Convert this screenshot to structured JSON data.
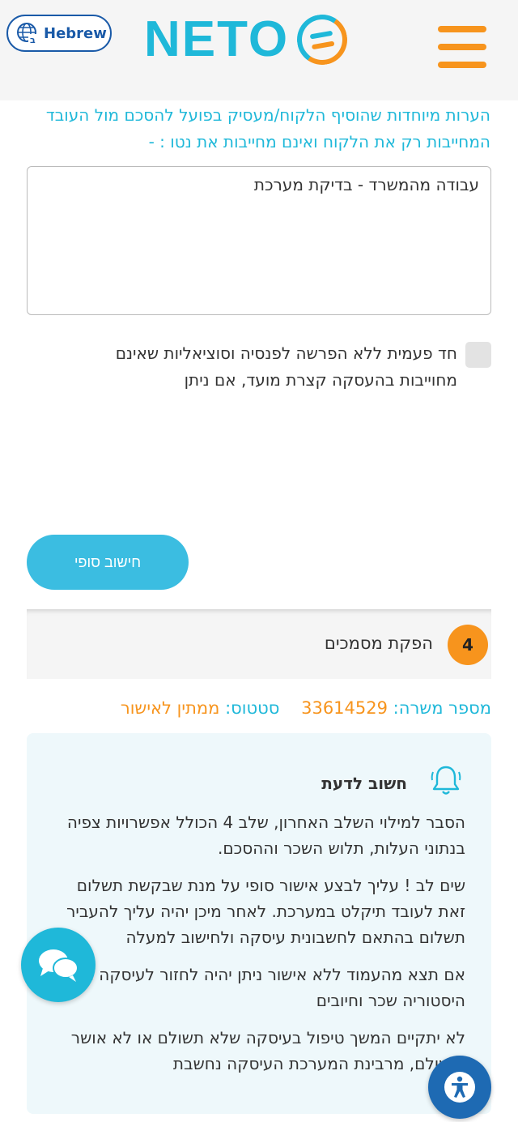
{
  "header": {
    "language_label": "Hebrew",
    "logo_text": "NETO"
  },
  "form": {
    "notes_label": "הערות מיוחדות שהוסיף הלקוח/מעסיק בפועל להסכם מול העובד המחייבות רק את הלקוח ואינם מחייבות את נטו : -",
    "notes_value": "עבודה מהמשרד - בדיקת מערכת",
    "checkbox_label": "חד פעמית ללא הפרשה לפנסיה וסוציאליות שאינם מחוייבות בהעסקה קצרת מועד, אם ניתן",
    "checkbox_checked": false,
    "calc_button_label": "חישוב סופי"
  },
  "step": {
    "number": "4",
    "title": "הפקת מסמכים"
  },
  "order": {
    "number_label": "מספר משרה:",
    "number_value": "33614529",
    "status_label": "סטטוס:",
    "status_value": "ממתין לאישור"
  },
  "info": {
    "title": "חשוב לדעת",
    "paragraphs": [
      "הסבר למילוי השלב האחרון, שלב 4 הכולל אפשרויות צפיה בנתוני העלות, תלוש השכר וההסכם.",
      "שים לב ! עליך לבצע אישור סופי על מנת שבקשת תשלום זאת לעובד תיקלט במערכת. לאחר מיכן יהיה עליך להעביר תשלום בהתאם לחשבונית עיסקה ולחישוב למעלה",
      "אם תצא מהעמוד ללא אישור ניתן יהיה לחזור לעיסקה ממסך היסטוריה שכר וחיובים",
      "לא יתקיים המשך טיפול בעיסקה שלא תשולם או לא אושר ותשולם, מרבינת המערכת העיסקה נחשבת"
    ]
  },
  "colors": {
    "brand_blue": "#1fb8d9",
    "brand_orange": "#f7941d",
    "accessibility_blue": "#1e6ab3"
  }
}
